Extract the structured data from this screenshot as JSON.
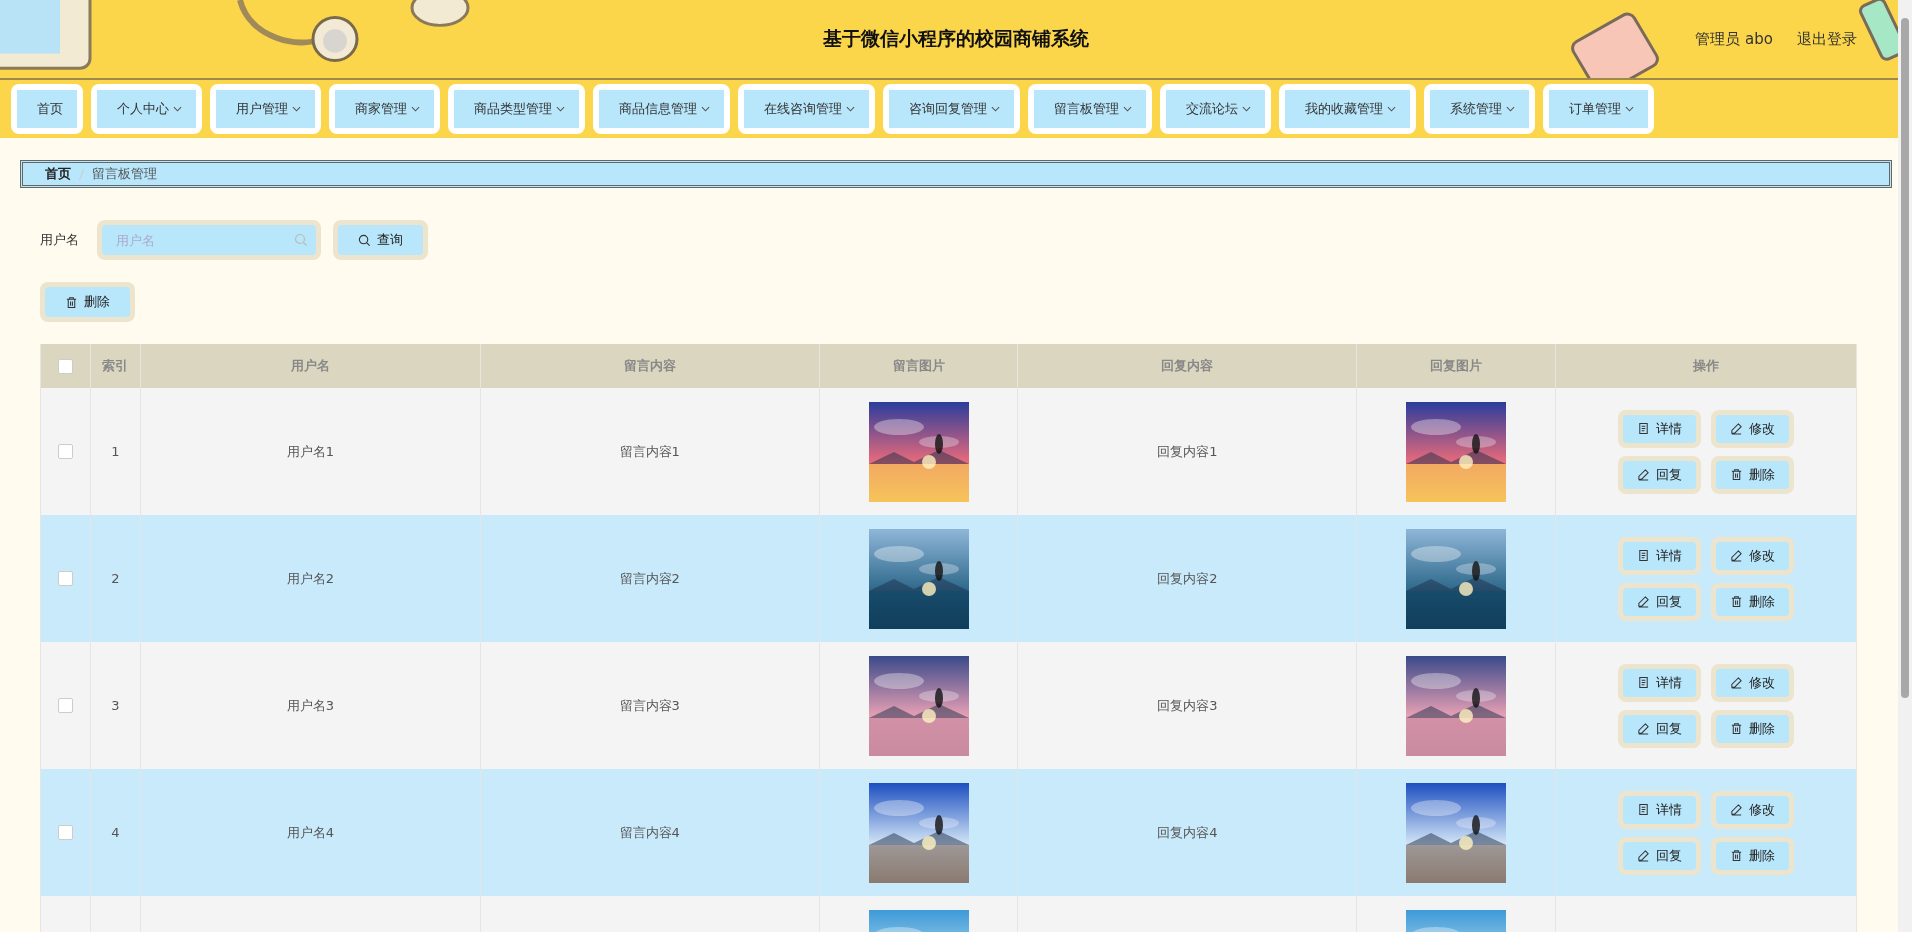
{
  "header": {
    "title": "基于微信小程序的校园商铺系统",
    "user": "管理员 abo",
    "logout": "退出登录"
  },
  "nav": [
    {
      "label": "首页",
      "dropdown": false
    },
    {
      "label": "个人中心",
      "dropdown": true
    },
    {
      "label": "用户管理",
      "dropdown": true
    },
    {
      "label": "商家管理",
      "dropdown": true
    },
    {
      "label": "商品类型管理",
      "dropdown": true
    },
    {
      "label": "商品信息管理",
      "dropdown": true
    },
    {
      "label": "在线咨询管理",
      "dropdown": true
    },
    {
      "label": "咨询回复管理",
      "dropdown": true
    },
    {
      "label": "留言板管理",
      "dropdown": true
    },
    {
      "label": "交流论坛",
      "dropdown": true
    },
    {
      "label": "我的收藏管理",
      "dropdown": true
    },
    {
      "label": "系统管理",
      "dropdown": true
    },
    {
      "label": "订单管理",
      "dropdown": true
    }
  ],
  "breadcrumb": [
    "首页",
    "留言板管理"
  ],
  "search": {
    "label": "用户名",
    "placeholder": "用户名",
    "button": "查询"
  },
  "delete_button": "删除",
  "table": {
    "header_checked": false,
    "columns": [
      "索引",
      "用户名",
      "留言内容",
      "留言图片",
      "回复内容",
      "回复图片",
      "操作"
    ],
    "rows": [
      {
        "selected": false,
        "index": "1",
        "username": "用户名1",
        "message": "留言内容1",
        "message_image": {
          "kind": "picture"
        },
        "reply": "回复内容1",
        "reply_image": {
          "kind": "picture"
        },
        "actions": [
          "详情",
          "修改",
          "回复",
          "删除"
        ]
      },
      {
        "selected": false,
        "index": "2",
        "username": "用户名2",
        "message": "留言内容2",
        "message_image": {
          "kind": "picture"
        },
        "reply": "回复内容2",
        "reply_image": {
          "kind": "picture"
        },
        "actions": [
          "详情",
          "修改",
          "回复",
          "删除"
        ]
      },
      {
        "selected": false,
        "index": "3",
        "username": "用户名3",
        "message": "留言内容3",
        "message_image": {
          "kind": "picture"
        },
        "reply": "回复内容3",
        "reply_image": {
          "kind": "picture"
        },
        "actions": [
          "详情",
          "修改",
          "回复",
          "删除"
        ]
      },
      {
        "selected": false,
        "index": "4",
        "username": "用户名4",
        "message": "留言内容4",
        "message_image": {
          "kind": "picture"
        },
        "reply": "回复内容4",
        "reply_image": {
          "kind": "picture"
        },
        "actions": [
          "详情",
          "修改",
          "回复",
          "删除"
        ]
      },
      {
        "message_image": {
          "kind": "picture"
        },
        "reply_image": {
          "kind": "picture"
        }
      }
    ]
  }
}
